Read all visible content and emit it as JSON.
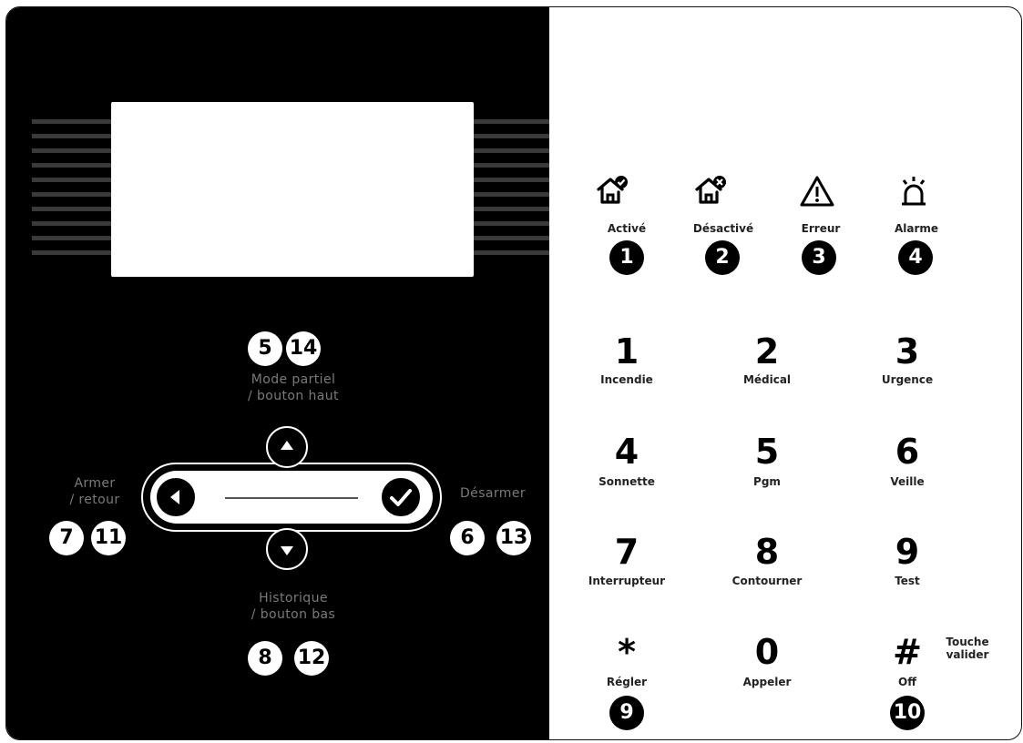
{
  "left_panel": {
    "up_label_line1": "Mode partiel",
    "up_label_line2": "/ bouton haut",
    "up_badges": [
      "5",
      "14"
    ],
    "left_label_line1": "Armer",
    "left_label_line2": "/ retour",
    "left_badges": [
      "7",
      "11"
    ],
    "right_label": "Désarmer",
    "right_badges": [
      "6",
      "13"
    ],
    "down_label_line1": "Historique",
    "down_label_line2": "/ bouton bas",
    "down_badges": [
      "8",
      "12"
    ]
  },
  "status": [
    {
      "label": "Activé",
      "badge": "1",
      "icon": "house-check-icon"
    },
    {
      "label": "Désactivé",
      "badge": "2",
      "icon": "house-x-icon"
    },
    {
      "label": "Erreur",
      "badge": "3",
      "icon": "warning-triangle-icon"
    },
    {
      "label": "Alarme",
      "badge": "4",
      "icon": "alarm-siren-icon"
    }
  ],
  "keypad": [
    {
      "digit": "1",
      "label": "Incendie"
    },
    {
      "digit": "2",
      "label": "Médical"
    },
    {
      "digit": "3",
      "label": "Urgence"
    },
    {
      "digit": "4",
      "label": "Sonnette"
    },
    {
      "digit": "5",
      "label": "Pgm"
    },
    {
      "digit": "6",
      "label": "Veille"
    },
    {
      "digit": "7",
      "label": "Interrupteur"
    },
    {
      "digit": "8",
      "label": "Contourner"
    },
    {
      "digit": "9",
      "label": "Test"
    },
    {
      "digit": "*",
      "label": "Régler",
      "badge": "9"
    },
    {
      "digit": "0",
      "label": "Appeler"
    },
    {
      "digit": "#",
      "label": "Off",
      "badge": "10"
    }
  ],
  "hash_note_line1": "Touche",
  "hash_note_line2": "valider"
}
